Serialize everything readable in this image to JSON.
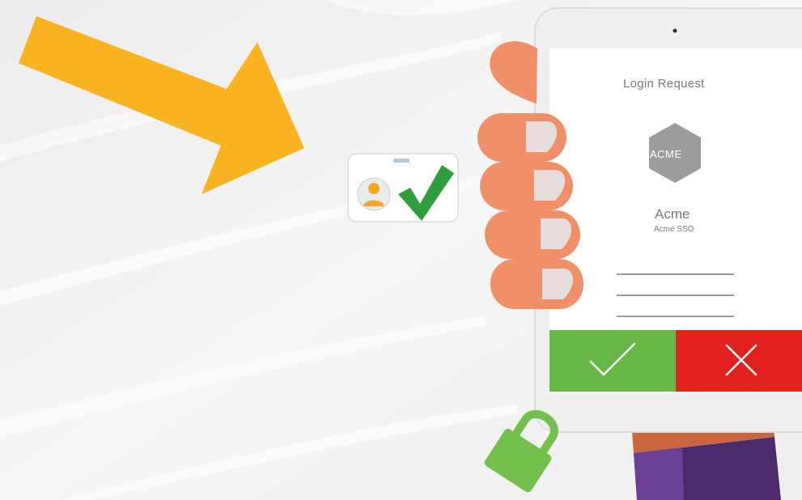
{
  "login_request": {
    "title": "Login Request",
    "logo_text": "ACME",
    "app_name": "Acme",
    "app_subtitle": "Acme SSO"
  },
  "icons": {
    "pointer": "arrow-icon",
    "badge": "user-badge-icon",
    "badge_check": "check-icon",
    "approve": "check-icon",
    "deny": "close-icon",
    "lock": "padlock-icon"
  },
  "colors": {
    "background": "#f1f1f1",
    "arrow": "#fbb321",
    "approve": "#67b846",
    "deny": "#e0211d",
    "hand": "#ef9069",
    "sleeve": "#4b2a6c",
    "lock": "#74c04c",
    "logo_hex": "#9c9c9c",
    "text": "#7a7a7a",
    "device_frame": "#efefef",
    "screen": "#ffffff"
  }
}
